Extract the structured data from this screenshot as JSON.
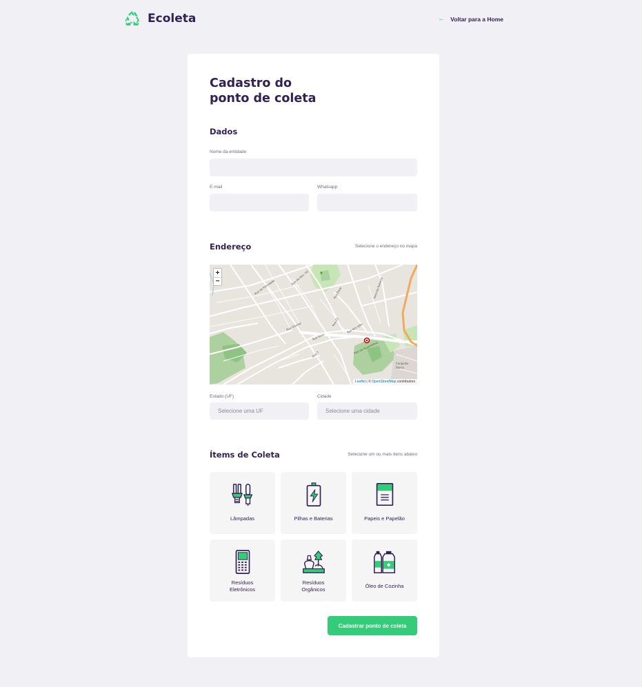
{
  "app": {
    "name": "Ecoleta",
    "back_link": "Voltar para a Home"
  },
  "form": {
    "title_line1": "Cadastro do",
    "title_line2": "ponto de coleta",
    "dados": {
      "legend": "Dados",
      "name_label": "Nome da entidade",
      "name_value": "",
      "email_label": "E-mail",
      "email_value": "",
      "whatsapp_label": "Whatsapp",
      "whatsapp_value": ""
    },
    "endereco": {
      "legend": "Endereço",
      "hint": "Selecione o endereço no mapa",
      "uf_label": "Estado (UF)",
      "uf_value": "Selecione uma UF",
      "city_label": "Cidade",
      "city_value": "Selecione uma cidade"
    },
    "map": {
      "zoom_in": "+",
      "zoom_out": "−",
      "attribution_leaflet": "Leaflet",
      "attribution_sep": " | © ",
      "attribution_osm": "OpenStreetMap",
      "attribution_rest": " contributors"
    },
    "itens": {
      "legend": "Ítems de Coleta",
      "hint": "Selecione um ou mais ítens abaixo",
      "list": [
        {
          "label": "Lâmpadas",
          "icon": "lamp-icon"
        },
        {
          "label": "Pilhas e Baterias",
          "icon": "battery-icon"
        },
        {
          "label": "Papeis e Papelão",
          "icon": "paper-icon"
        },
        {
          "label": "Resíduos Eletrônicos",
          "label_line1": "Resíduos",
          "label_line2": "Eletrônicos",
          "icon": "electronics-icon"
        },
        {
          "label": "Resíduos Orgânicos",
          "label_line1": "Resíduos",
          "label_line2": "Orgânicos",
          "icon": "organic-icon"
        },
        {
          "label": "Óleo de Cozinha",
          "icon": "oil-icon"
        }
      ]
    },
    "submit_label": "Cadastrar ponto de coleta"
  },
  "colors": {
    "primary": "#34cb79",
    "title": "#322153",
    "text": "#6c6c80",
    "background": "#f0f0f5"
  }
}
